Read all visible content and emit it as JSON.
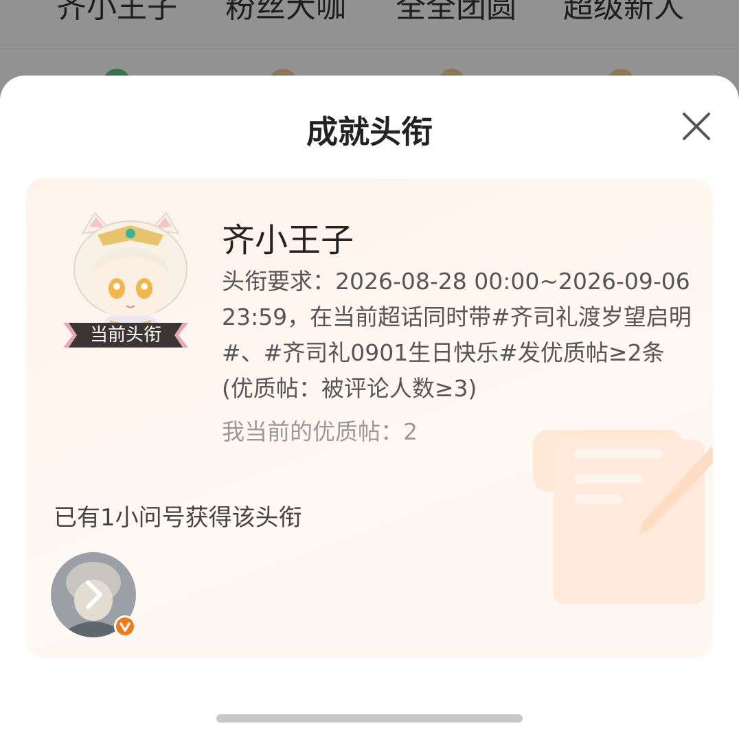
{
  "background": {
    "tabs": [
      "齐小王子",
      "粉丝大咖",
      "全全团圆",
      "超级新人"
    ]
  },
  "sheet": {
    "title": "成就头衔",
    "close_icon": "close-icon"
  },
  "card": {
    "badge_label": "当前头衔",
    "title_name": "齐小王子",
    "requirement": "头衔要求：2026-08-28 00:00~2026-09-06 23:59，在当前超话同时带#齐司礼渡岁望启明#、#齐司礼0901生日快乐#发优质帖≥2条(优质帖：被评论人数≥3)",
    "my_posts_label": "我当前的优质帖：",
    "my_posts_value": "2",
    "owners_text": "已有1小问号获得该头衔",
    "owners": [
      {
        "avatar_icon": "user-avatar",
        "verified_icon": "verified-badge-icon",
        "arrow_icon": "chevron-right-icon"
      }
    ]
  },
  "colors": {
    "card_bg": "#fff5ee",
    "badge_bg": "#3b3536",
    "badge_ribbon": "#e8a8b0",
    "verified": "#f07a1a"
  }
}
